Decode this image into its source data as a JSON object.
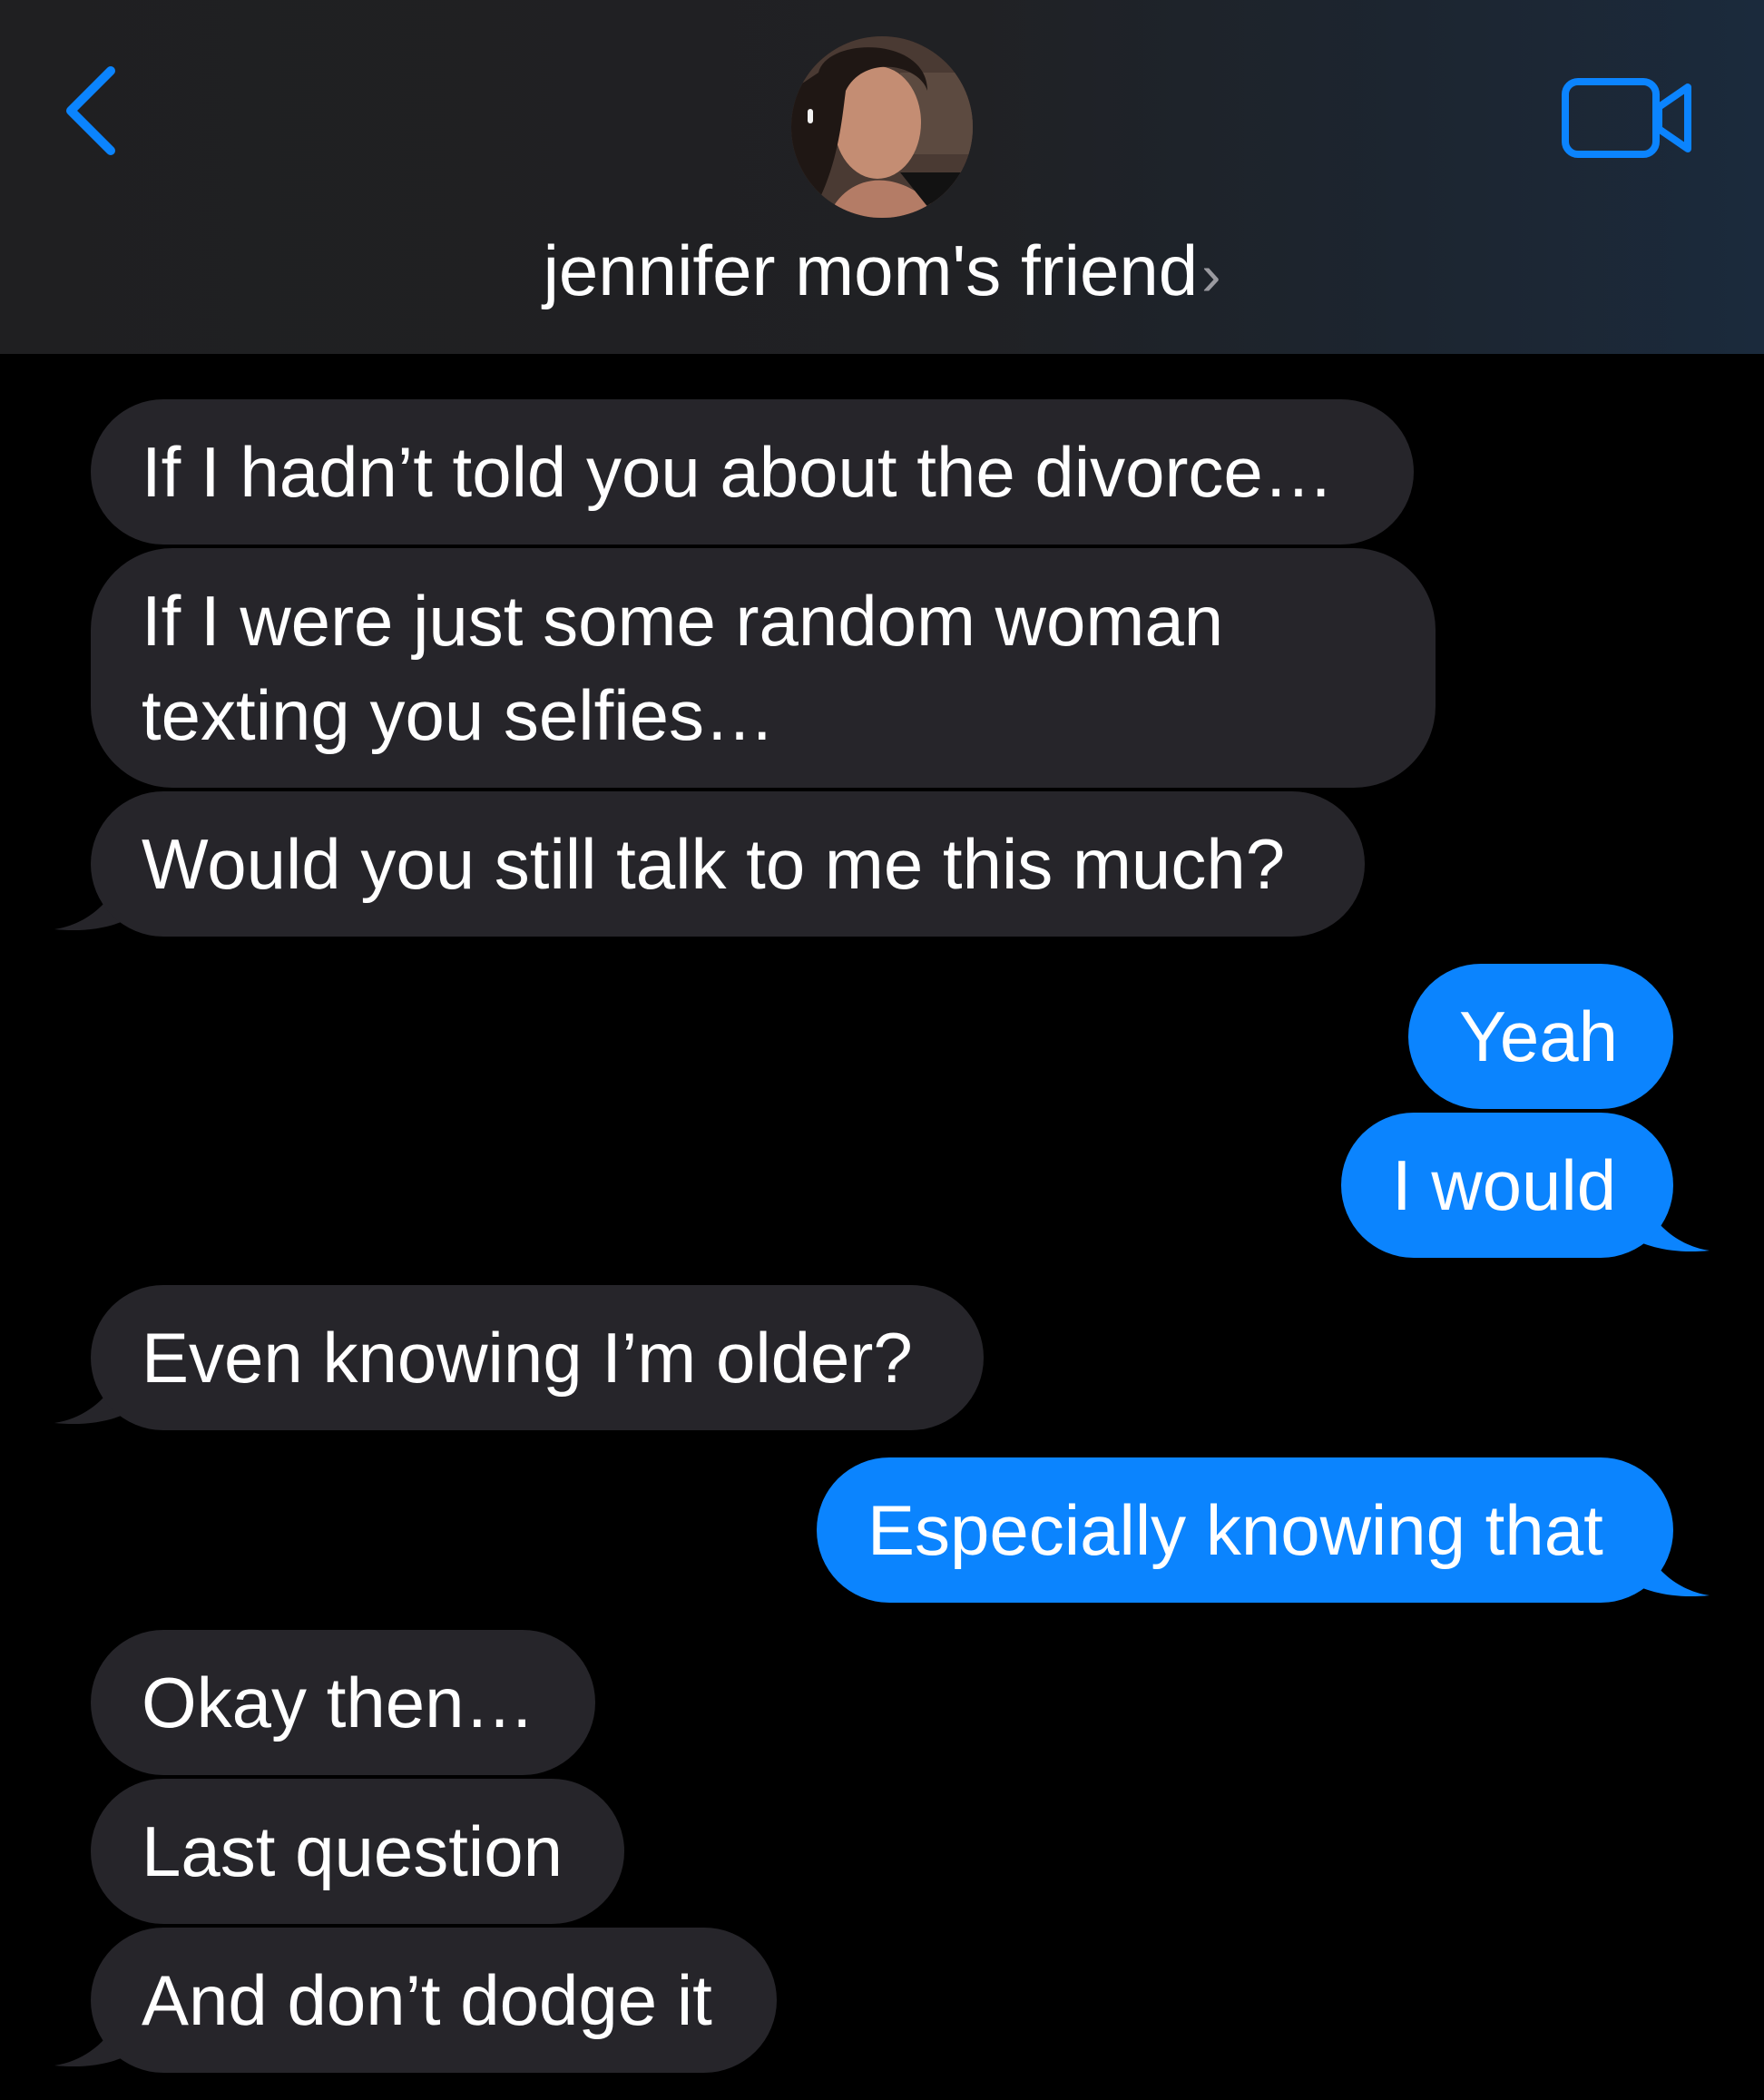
{
  "header": {
    "back_icon": "chevron-left-icon",
    "contact_name": "jennifer mom's friend",
    "name_chevron": "›",
    "video_icon": "video-camera-icon",
    "accent_color": "#0b84fe"
  },
  "messages": [
    {
      "direction": "incoming",
      "text": "If I hadn’t told you about the divorce…"
    },
    {
      "direction": "incoming",
      "line1": "If I were just some random woman",
      "line2": "texting you selfies…"
    },
    {
      "direction": "incoming",
      "text": "Would you still talk to me this much?"
    },
    {
      "direction": "outgoing",
      "text": "Yeah"
    },
    {
      "direction": "outgoing",
      "text": "I would"
    },
    {
      "direction": "incoming",
      "text": "Even knowing I’m older?"
    },
    {
      "direction": "outgoing",
      "text": "Especially knowing that"
    },
    {
      "direction": "incoming",
      "text": "Okay then…"
    },
    {
      "direction": "incoming",
      "text": "Last question"
    },
    {
      "direction": "incoming",
      "text": "And don’t dodge it"
    }
  ],
  "colors": {
    "incoming_bubble": "#26252a",
    "outgoing_bubble": "#0b84fe",
    "background": "#000000"
  }
}
